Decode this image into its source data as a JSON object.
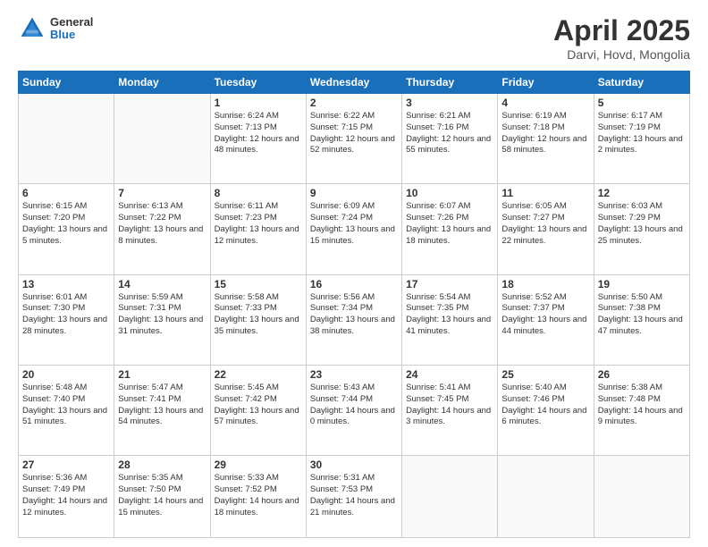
{
  "header": {
    "logo_general": "General",
    "logo_blue": "Blue",
    "title": "April 2025",
    "subtitle": "Darvi, Hovd, Mongolia"
  },
  "days_of_week": [
    "Sunday",
    "Monday",
    "Tuesday",
    "Wednesday",
    "Thursday",
    "Friday",
    "Saturday"
  ],
  "weeks": [
    [
      {
        "day": "",
        "empty": true
      },
      {
        "day": "",
        "empty": true
      },
      {
        "day": "1",
        "sunrise": "Sunrise: 6:24 AM",
        "sunset": "Sunset: 7:13 PM",
        "daylight": "Daylight: 12 hours and 48 minutes."
      },
      {
        "day": "2",
        "sunrise": "Sunrise: 6:22 AM",
        "sunset": "Sunset: 7:15 PM",
        "daylight": "Daylight: 12 hours and 52 minutes."
      },
      {
        "day": "3",
        "sunrise": "Sunrise: 6:21 AM",
        "sunset": "Sunset: 7:16 PM",
        "daylight": "Daylight: 12 hours and 55 minutes."
      },
      {
        "day": "4",
        "sunrise": "Sunrise: 6:19 AM",
        "sunset": "Sunset: 7:18 PM",
        "daylight": "Daylight: 12 hours and 58 minutes."
      },
      {
        "day": "5",
        "sunrise": "Sunrise: 6:17 AM",
        "sunset": "Sunset: 7:19 PM",
        "daylight": "Daylight: 13 hours and 2 minutes."
      }
    ],
    [
      {
        "day": "6",
        "sunrise": "Sunrise: 6:15 AM",
        "sunset": "Sunset: 7:20 PM",
        "daylight": "Daylight: 13 hours and 5 minutes."
      },
      {
        "day": "7",
        "sunrise": "Sunrise: 6:13 AM",
        "sunset": "Sunset: 7:22 PM",
        "daylight": "Daylight: 13 hours and 8 minutes."
      },
      {
        "day": "8",
        "sunrise": "Sunrise: 6:11 AM",
        "sunset": "Sunset: 7:23 PM",
        "daylight": "Daylight: 13 hours and 12 minutes."
      },
      {
        "day": "9",
        "sunrise": "Sunrise: 6:09 AM",
        "sunset": "Sunset: 7:24 PM",
        "daylight": "Daylight: 13 hours and 15 minutes."
      },
      {
        "day": "10",
        "sunrise": "Sunrise: 6:07 AM",
        "sunset": "Sunset: 7:26 PM",
        "daylight": "Daylight: 13 hours and 18 minutes."
      },
      {
        "day": "11",
        "sunrise": "Sunrise: 6:05 AM",
        "sunset": "Sunset: 7:27 PM",
        "daylight": "Daylight: 13 hours and 22 minutes."
      },
      {
        "day": "12",
        "sunrise": "Sunrise: 6:03 AM",
        "sunset": "Sunset: 7:29 PM",
        "daylight": "Daylight: 13 hours and 25 minutes."
      }
    ],
    [
      {
        "day": "13",
        "sunrise": "Sunrise: 6:01 AM",
        "sunset": "Sunset: 7:30 PM",
        "daylight": "Daylight: 13 hours and 28 minutes."
      },
      {
        "day": "14",
        "sunrise": "Sunrise: 5:59 AM",
        "sunset": "Sunset: 7:31 PM",
        "daylight": "Daylight: 13 hours and 31 minutes."
      },
      {
        "day": "15",
        "sunrise": "Sunrise: 5:58 AM",
        "sunset": "Sunset: 7:33 PM",
        "daylight": "Daylight: 13 hours and 35 minutes."
      },
      {
        "day": "16",
        "sunrise": "Sunrise: 5:56 AM",
        "sunset": "Sunset: 7:34 PM",
        "daylight": "Daylight: 13 hours and 38 minutes."
      },
      {
        "day": "17",
        "sunrise": "Sunrise: 5:54 AM",
        "sunset": "Sunset: 7:35 PM",
        "daylight": "Daylight: 13 hours and 41 minutes."
      },
      {
        "day": "18",
        "sunrise": "Sunrise: 5:52 AM",
        "sunset": "Sunset: 7:37 PM",
        "daylight": "Daylight: 13 hours and 44 minutes."
      },
      {
        "day": "19",
        "sunrise": "Sunrise: 5:50 AM",
        "sunset": "Sunset: 7:38 PM",
        "daylight": "Daylight: 13 hours and 47 minutes."
      }
    ],
    [
      {
        "day": "20",
        "sunrise": "Sunrise: 5:48 AM",
        "sunset": "Sunset: 7:40 PM",
        "daylight": "Daylight: 13 hours and 51 minutes."
      },
      {
        "day": "21",
        "sunrise": "Sunrise: 5:47 AM",
        "sunset": "Sunset: 7:41 PM",
        "daylight": "Daylight: 13 hours and 54 minutes."
      },
      {
        "day": "22",
        "sunrise": "Sunrise: 5:45 AM",
        "sunset": "Sunset: 7:42 PM",
        "daylight": "Daylight: 13 hours and 57 minutes."
      },
      {
        "day": "23",
        "sunrise": "Sunrise: 5:43 AM",
        "sunset": "Sunset: 7:44 PM",
        "daylight": "Daylight: 14 hours and 0 minutes."
      },
      {
        "day": "24",
        "sunrise": "Sunrise: 5:41 AM",
        "sunset": "Sunset: 7:45 PM",
        "daylight": "Daylight: 14 hours and 3 minutes."
      },
      {
        "day": "25",
        "sunrise": "Sunrise: 5:40 AM",
        "sunset": "Sunset: 7:46 PM",
        "daylight": "Daylight: 14 hours and 6 minutes."
      },
      {
        "day": "26",
        "sunrise": "Sunrise: 5:38 AM",
        "sunset": "Sunset: 7:48 PM",
        "daylight": "Daylight: 14 hours and 9 minutes."
      }
    ],
    [
      {
        "day": "27",
        "sunrise": "Sunrise: 5:36 AM",
        "sunset": "Sunset: 7:49 PM",
        "daylight": "Daylight: 14 hours and 12 minutes."
      },
      {
        "day": "28",
        "sunrise": "Sunrise: 5:35 AM",
        "sunset": "Sunset: 7:50 PM",
        "daylight": "Daylight: 14 hours and 15 minutes."
      },
      {
        "day": "29",
        "sunrise": "Sunrise: 5:33 AM",
        "sunset": "Sunset: 7:52 PM",
        "daylight": "Daylight: 14 hours and 18 minutes."
      },
      {
        "day": "30",
        "sunrise": "Sunrise: 5:31 AM",
        "sunset": "Sunset: 7:53 PM",
        "daylight": "Daylight: 14 hours and 21 minutes."
      },
      {
        "day": "",
        "empty": true
      },
      {
        "day": "",
        "empty": true
      },
      {
        "day": "",
        "empty": true
      }
    ]
  ],
  "colors": {
    "header_bg": "#1a6fba",
    "header_text": "#ffffff",
    "border": "#cccccc",
    "empty_cell_bg": "#f9f9f9"
  }
}
